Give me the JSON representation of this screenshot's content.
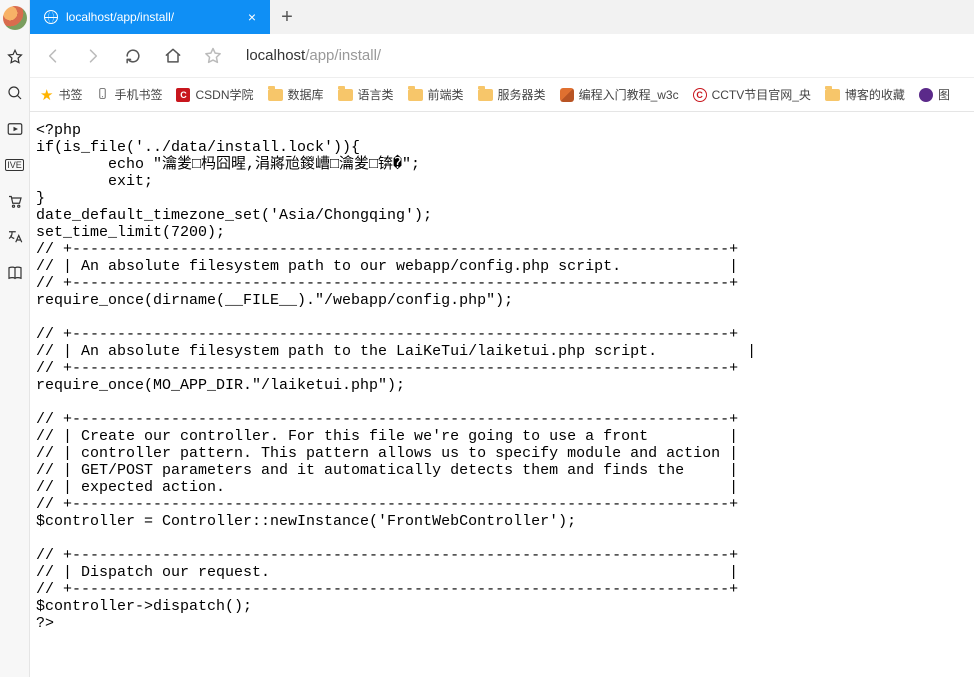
{
  "tab": {
    "title": "localhost/app/install/"
  },
  "url": {
    "host": "localhost",
    "path": "/app/install/"
  },
  "bookmarks": {
    "b0": "书签",
    "b1": "手机书签",
    "b2": "CSDN学院",
    "b3": "数据库",
    "b4": "语言类",
    "b5": "前端类",
    "b6": "服务器类",
    "b7": "编程入门教程_w3c",
    "b8": "CCTV节目官网_央",
    "b9": "博客的收藏",
    "b10": "图"
  },
  "code": "<?php\nif(is_file('../data/install.lock')){\n        echo \"瀹夎□杩囧暒,涓嶈兘鍐嶆□瀹夎□锛�\";\n        exit;\n}\ndate_default_timezone_set('Asia/Chongqing');\nset_time_limit(7200);\n// +-------------------------------------------------------------------------+\n// | An absolute filesystem path to our webapp/config.php script.            |\n// +-------------------------------------------------------------------------+\nrequire_once(dirname(__FILE__).\"/webapp/config.php\");\n\n// +-------------------------------------------------------------------------+\n// | An absolute filesystem path to the LaiKeTui/laiketui.php script.          |\n// +-------------------------------------------------------------------------+\nrequire_once(MO_APP_DIR.\"/laiketui.php\");\n\n// +-------------------------------------------------------------------------+\n// | Create our controller. For this file we're going to use a front         |\n// | controller pattern. This pattern allows us to specify module and action |\n// | GET/POST parameters and it automatically detects them and finds the     |\n// | expected action.                                                        |\n// +-------------------------------------------------------------------------+\n$controller = Controller::newInstance('FrontWebController');\n\n// +-------------------------------------------------------------------------+\n// | Dispatch our request.                                                   |\n// +-------------------------------------------------------------------------+\n$controller->dispatch();\n?>"
}
